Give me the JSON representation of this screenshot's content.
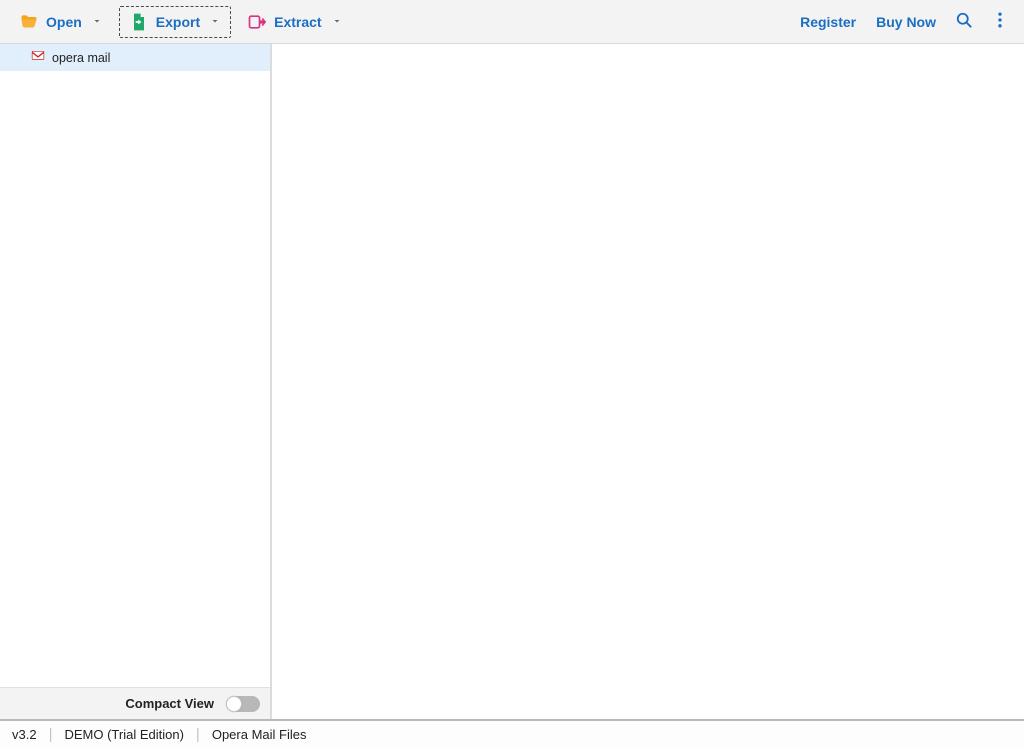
{
  "toolbar": {
    "open": "Open",
    "export": "Export",
    "extract": "Extract",
    "register": "Register",
    "buy_now": "Buy Now"
  },
  "sidebar": {
    "items": [
      {
        "label": "opera mail"
      }
    ],
    "compact_view": "Compact View"
  },
  "statusbar": {
    "version": "v3.2",
    "edition": "DEMO (Trial Edition)",
    "context": "Opera Mail Files"
  }
}
